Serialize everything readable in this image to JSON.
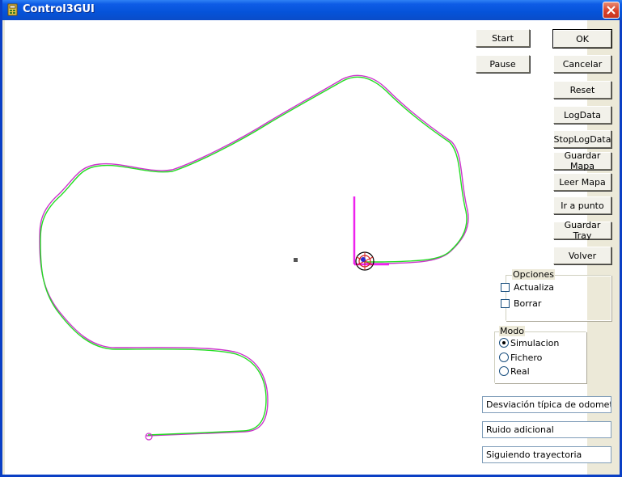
{
  "window": {
    "title": "Control3GUI"
  },
  "buttons": {
    "start": "Start",
    "pause": "Pause",
    "ok": "OK",
    "cancelar": "Cancelar",
    "reset": "Reset",
    "logdata": "LogData",
    "stoplogdata": "StopLogData",
    "guardar_mapa": "Guardar Mapa",
    "leer_mapa": "Leer Mapa",
    "ir_a_punto": "Ir a punto",
    "guardar_tray": "Guardar Tray",
    "volver": "Volver"
  },
  "opciones": {
    "title": "Opciones",
    "actualiza": {
      "label": "Actualiza",
      "checked": false
    },
    "borrar": {
      "label": "Borrar",
      "checked": false
    }
  },
  "modo": {
    "title": "Modo",
    "options": [
      "Simulacion",
      "Fichero",
      "Real"
    ],
    "selected": "Simulacion"
  },
  "fields": {
    "desviacion": "Desviación típica de odometría",
    "ruido": "Ruido adicional",
    "estado": "Siguiendo trayectoria"
  },
  "colors": {
    "titlebar": "#0553d9",
    "path_green": "#22dd22",
    "path_magenta": "#cc33cc",
    "axis_magenta": "#ee22ee"
  }
}
